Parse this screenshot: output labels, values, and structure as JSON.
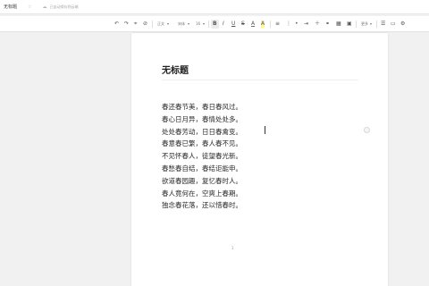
{
  "window": {
    "doc_title": "无标题",
    "star_icon": "star-icon",
    "save_status": "已自动保存到云端"
  },
  "toolbar": {
    "style_label": "正文",
    "font_label": "宋体",
    "size_label": "16",
    "bold": "B",
    "italic": "I",
    "underline": "U",
    "strike": "S",
    "font_color": "A",
    "highlight": "A",
    "more_label": "更多"
  },
  "document": {
    "title": "无标题",
    "lines": [
      "春还春节美，春日春风过。",
      "春心日月异，春情处处多。",
      "处处春芳动，日日春禽变。",
      "春意春已繁，春人春不见。",
      "不见怀春人，徒望春光新。",
      "春愁春自结，春结讵能申。",
      "欲道春园趣，复忆春时人。",
      "春人竟何在，空爽上春期。",
      "独念春花落，还以惜春时。"
    ],
    "page_number": "1"
  },
  "colors": {
    "page_bg": "#ffffff",
    "canvas_bg": "#f1f1f1",
    "text": "#2a2a2a"
  }
}
